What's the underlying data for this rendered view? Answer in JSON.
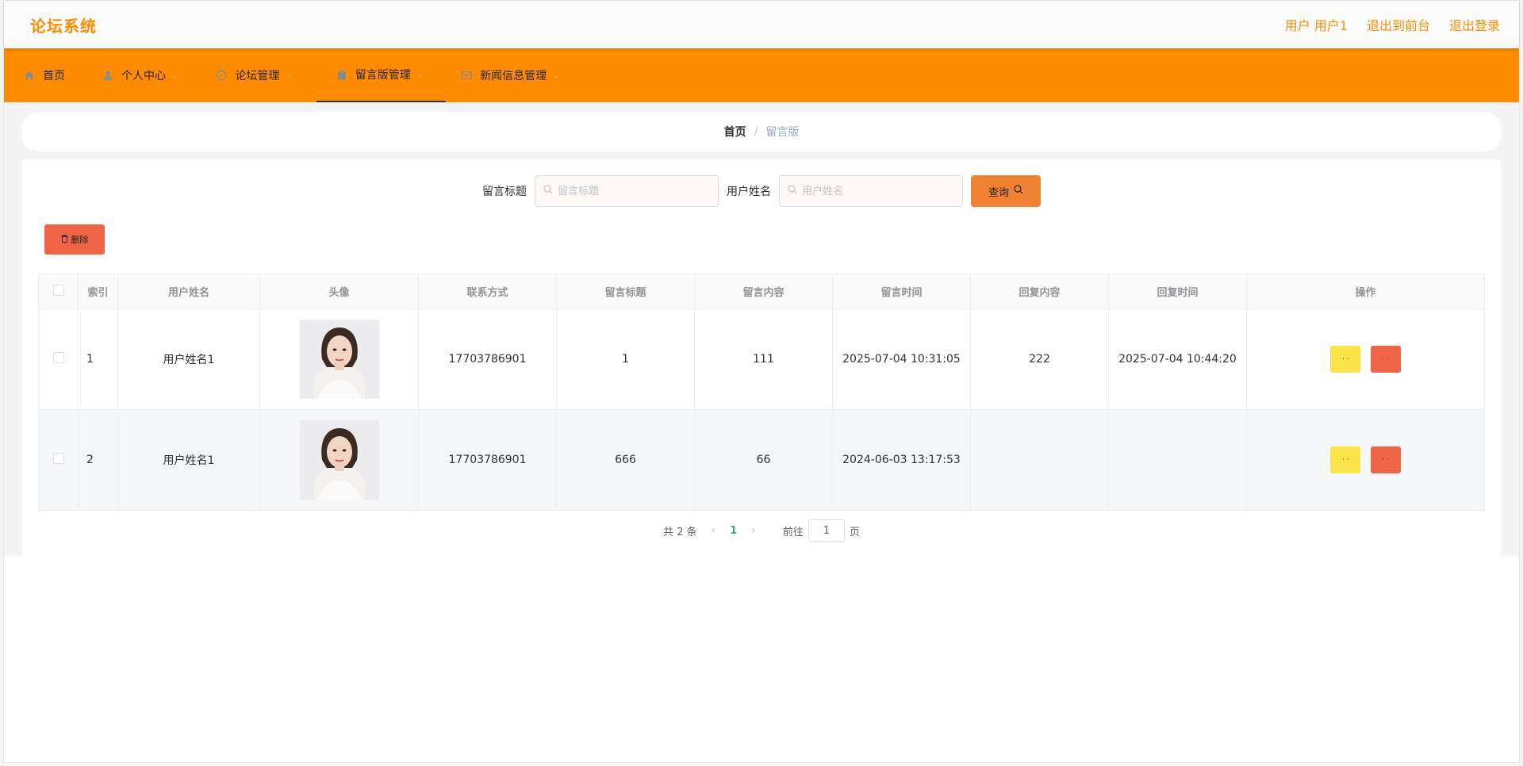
{
  "header": {
    "brand": "论坛系统",
    "user_label": "用户 用户1",
    "back_front": "退出到前台",
    "logout": "退出登录"
  },
  "nav": {
    "items": [
      {
        "label": "首页",
        "icon": "home-icon"
      },
      {
        "label": "个人中心",
        "icon": "user-icon"
      },
      {
        "label": "论坛管理",
        "icon": "compass-icon"
      },
      {
        "label": "留言版管理",
        "icon": "clipboard-icon"
      },
      {
        "label": "新闻信息管理",
        "icon": "mail-icon"
      }
    ],
    "active_index": 3
  },
  "breadcrumb": {
    "home": "首页",
    "sep": "/",
    "current": "留言版"
  },
  "search": {
    "title_label": "留言标题",
    "title_placeholder": "留言标题",
    "name_label": "用户姓名",
    "name_placeholder": "用户姓名",
    "query_btn": "查询"
  },
  "delete_btn": "删除",
  "table": {
    "headers": [
      "索引",
      "用户姓名",
      "头像",
      "联系方式",
      "留言标题",
      "留言内容",
      "留言时间",
      "回复内容",
      "回复时间",
      "操作"
    ],
    "rows": [
      {
        "index": "1",
        "name": "用户姓名1",
        "phone": "17703786901",
        "title": "1",
        "content": "111",
        "time": "2025-07-04 10:31:05",
        "reply": "222",
        "reply_time": "2025-07-04 10:44:20"
      },
      {
        "index": "2",
        "name": "用户姓名1",
        "phone": "17703786901",
        "title": "666",
        "content": "66",
        "time": "2024-06-03 13:17:53",
        "reply": "",
        "reply_time": ""
      }
    ],
    "op_btn_text": "· ·"
  },
  "pager": {
    "total": "共 2 条",
    "page": "1",
    "goto_label": "前往",
    "goto_value": "1",
    "page_unit": "页"
  },
  "colors": {
    "accent": "#ff8c00",
    "search_btn": "#f08232",
    "danger": "#ef6546",
    "warning": "#fde34c",
    "pager_active": "#2dab8c"
  }
}
